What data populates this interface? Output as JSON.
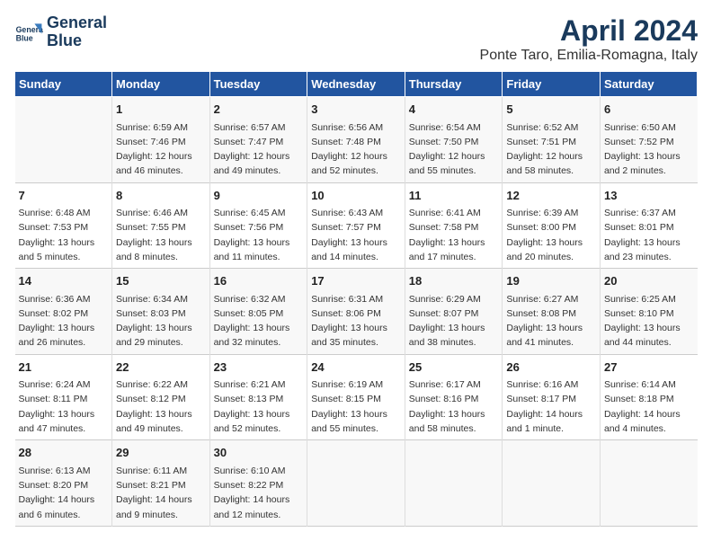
{
  "header": {
    "logo_line1": "General",
    "logo_line2": "Blue",
    "month_title": "April 2024",
    "location": "Ponte Taro, Emilia-Romagna, Italy"
  },
  "days_of_week": [
    "Sunday",
    "Monday",
    "Tuesday",
    "Wednesday",
    "Thursday",
    "Friday",
    "Saturday"
  ],
  "weeks": [
    [
      {
        "day": "",
        "info": ""
      },
      {
        "day": "1",
        "info": "Sunrise: 6:59 AM\nSunset: 7:46 PM\nDaylight: 12 hours\nand 46 minutes."
      },
      {
        "day": "2",
        "info": "Sunrise: 6:57 AM\nSunset: 7:47 PM\nDaylight: 12 hours\nand 49 minutes."
      },
      {
        "day": "3",
        "info": "Sunrise: 6:56 AM\nSunset: 7:48 PM\nDaylight: 12 hours\nand 52 minutes."
      },
      {
        "day": "4",
        "info": "Sunrise: 6:54 AM\nSunset: 7:50 PM\nDaylight: 12 hours\nand 55 minutes."
      },
      {
        "day": "5",
        "info": "Sunrise: 6:52 AM\nSunset: 7:51 PM\nDaylight: 12 hours\nand 58 minutes."
      },
      {
        "day": "6",
        "info": "Sunrise: 6:50 AM\nSunset: 7:52 PM\nDaylight: 13 hours\nand 2 minutes."
      }
    ],
    [
      {
        "day": "7",
        "info": "Sunrise: 6:48 AM\nSunset: 7:53 PM\nDaylight: 13 hours\nand 5 minutes."
      },
      {
        "day": "8",
        "info": "Sunrise: 6:46 AM\nSunset: 7:55 PM\nDaylight: 13 hours\nand 8 minutes."
      },
      {
        "day": "9",
        "info": "Sunrise: 6:45 AM\nSunset: 7:56 PM\nDaylight: 13 hours\nand 11 minutes."
      },
      {
        "day": "10",
        "info": "Sunrise: 6:43 AM\nSunset: 7:57 PM\nDaylight: 13 hours\nand 14 minutes."
      },
      {
        "day": "11",
        "info": "Sunrise: 6:41 AM\nSunset: 7:58 PM\nDaylight: 13 hours\nand 17 minutes."
      },
      {
        "day": "12",
        "info": "Sunrise: 6:39 AM\nSunset: 8:00 PM\nDaylight: 13 hours\nand 20 minutes."
      },
      {
        "day": "13",
        "info": "Sunrise: 6:37 AM\nSunset: 8:01 PM\nDaylight: 13 hours\nand 23 minutes."
      }
    ],
    [
      {
        "day": "14",
        "info": "Sunrise: 6:36 AM\nSunset: 8:02 PM\nDaylight: 13 hours\nand 26 minutes."
      },
      {
        "day": "15",
        "info": "Sunrise: 6:34 AM\nSunset: 8:03 PM\nDaylight: 13 hours\nand 29 minutes."
      },
      {
        "day": "16",
        "info": "Sunrise: 6:32 AM\nSunset: 8:05 PM\nDaylight: 13 hours\nand 32 minutes."
      },
      {
        "day": "17",
        "info": "Sunrise: 6:31 AM\nSunset: 8:06 PM\nDaylight: 13 hours\nand 35 minutes."
      },
      {
        "day": "18",
        "info": "Sunrise: 6:29 AM\nSunset: 8:07 PM\nDaylight: 13 hours\nand 38 minutes."
      },
      {
        "day": "19",
        "info": "Sunrise: 6:27 AM\nSunset: 8:08 PM\nDaylight: 13 hours\nand 41 minutes."
      },
      {
        "day": "20",
        "info": "Sunrise: 6:25 AM\nSunset: 8:10 PM\nDaylight: 13 hours\nand 44 minutes."
      }
    ],
    [
      {
        "day": "21",
        "info": "Sunrise: 6:24 AM\nSunset: 8:11 PM\nDaylight: 13 hours\nand 47 minutes."
      },
      {
        "day": "22",
        "info": "Sunrise: 6:22 AM\nSunset: 8:12 PM\nDaylight: 13 hours\nand 49 minutes."
      },
      {
        "day": "23",
        "info": "Sunrise: 6:21 AM\nSunset: 8:13 PM\nDaylight: 13 hours\nand 52 minutes."
      },
      {
        "day": "24",
        "info": "Sunrise: 6:19 AM\nSunset: 8:15 PM\nDaylight: 13 hours\nand 55 minutes."
      },
      {
        "day": "25",
        "info": "Sunrise: 6:17 AM\nSunset: 8:16 PM\nDaylight: 13 hours\nand 58 minutes."
      },
      {
        "day": "26",
        "info": "Sunrise: 6:16 AM\nSunset: 8:17 PM\nDaylight: 14 hours\nand 1 minute."
      },
      {
        "day": "27",
        "info": "Sunrise: 6:14 AM\nSunset: 8:18 PM\nDaylight: 14 hours\nand 4 minutes."
      }
    ],
    [
      {
        "day": "28",
        "info": "Sunrise: 6:13 AM\nSunset: 8:20 PM\nDaylight: 14 hours\nand 6 minutes."
      },
      {
        "day": "29",
        "info": "Sunrise: 6:11 AM\nSunset: 8:21 PM\nDaylight: 14 hours\nand 9 minutes."
      },
      {
        "day": "30",
        "info": "Sunrise: 6:10 AM\nSunset: 8:22 PM\nDaylight: 14 hours\nand 12 minutes."
      },
      {
        "day": "",
        "info": ""
      },
      {
        "day": "",
        "info": ""
      },
      {
        "day": "",
        "info": ""
      },
      {
        "day": "",
        "info": ""
      }
    ]
  ]
}
